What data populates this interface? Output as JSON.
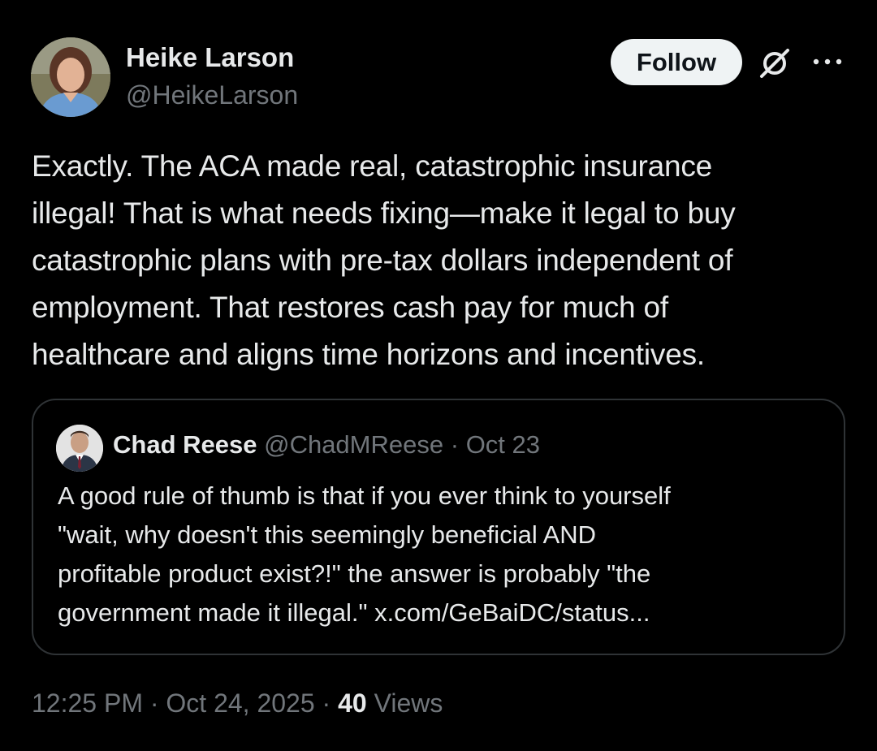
{
  "author": {
    "name": "Heike Larson",
    "handle": "@HeikeLarson"
  },
  "follow_label": "Follow",
  "post": {
    "text": "Exactly. The ACA made real, catastrophic insurance\nillegal! That is what needs fixing—make it legal to buy\ncatastrophic plans with pre-tax dollars independent of\nemployment. That restores cash pay for much of\nhealthcare and aligns time horizons and incentives."
  },
  "quote": {
    "name": "Chad Reese",
    "handle": "@ChadMReese",
    "separator": "·",
    "date": "Oct 23",
    "text": "A good rule of thumb is that if you ever think to yourself\n\"wait, why doesn't this seemingly beneficial AND\nprofitable product exist?!\" the answer is probably \"the\ngovernment made it illegal.\" x.com/GeBaiDC/status..."
  },
  "footer": {
    "time": "12:25 PM",
    "separator": "·",
    "date": "Oct 24, 2025",
    "views_count": "40",
    "views_label": "Views"
  },
  "icons": {
    "grok": "grok-icon",
    "more": "more-horizontal-icon"
  },
  "colors": {
    "background": "#000000",
    "text": "#e7e9ea",
    "secondary_text": "#71767b",
    "border": "#2f3336",
    "follow_bg": "#eff3f4"
  }
}
